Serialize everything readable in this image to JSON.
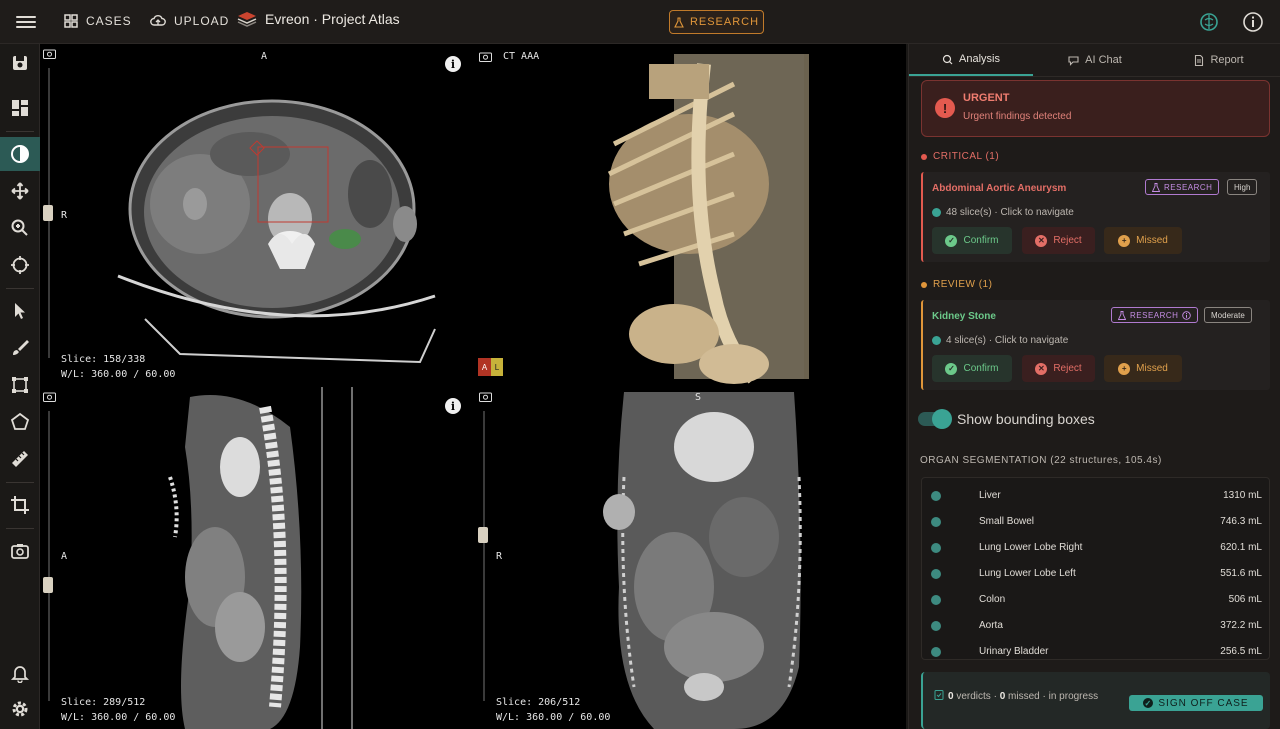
{
  "topbar": {
    "cases_label": "CASES",
    "upload_label": "UPLOAD",
    "brand_title": "Evreon · Project Atlas",
    "research_label": "RESEARCH"
  },
  "viewports": {
    "axial": {
      "orientation_top": "A",
      "orientation_left": "R",
      "slice": "Slice: 158/338",
      "wl": "W/L: 360.00 / 60.00"
    },
    "volume": {
      "label": "CT AAA",
      "orient_a": "A",
      "orient_l": "L"
    },
    "sagittal": {
      "orientation_left": "A",
      "slice": "Slice: 289/512",
      "wl": "W/L: 360.00 / 60.00"
    },
    "coronal": {
      "orientation_top": "S",
      "orientation_left": "R",
      "slice": "Slice: 206/512",
      "wl": "W/L: 360.00 / 60.00"
    }
  },
  "panel": {
    "tabs": [
      {
        "label": "Analysis",
        "icon": "brain-search-icon"
      },
      {
        "label": "AI Chat",
        "icon": "chat-icon"
      },
      {
        "label": "Report",
        "icon": "document-icon"
      }
    ],
    "urgent": {
      "title": "URGENT",
      "subtitle": "Urgent findings detected"
    },
    "critical_header": "CRITICAL (1)",
    "review_header": "REVIEW (1)",
    "findings": [
      {
        "title": "Abdominal Aortic Aneurysm",
        "badge": "RESEARCH",
        "severity": "High",
        "slices": "48 slice(s) · Click to navigate",
        "confirm": "Confirm",
        "reject": "Reject",
        "missed": "Missed",
        "color": "#e36e66"
      },
      {
        "title": "Kidney Stone",
        "badge": "RESEARCH",
        "severity": "Moderate",
        "slices": "4 slice(s) · Click to navigate",
        "confirm": "Confirm",
        "reject": "Reject",
        "missed": "Missed",
        "color": "#6cc98a"
      }
    ],
    "toggle_label": "Show bounding boxes",
    "segmentation_header": "ORGAN SEGMENTATION (22 structures, 105.4s)",
    "organs": [
      {
        "name": "Liver",
        "volume": "1310 mL"
      },
      {
        "name": "Small Bowel",
        "volume": "746.3 mL"
      },
      {
        "name": "Lung Lower Lobe Right",
        "volume": "620.1 mL"
      },
      {
        "name": "Lung Lower Lobe Left",
        "volume": "551.6 mL"
      },
      {
        "name": "Colon",
        "volume": "506 mL"
      },
      {
        "name": "Aorta",
        "volume": "372.2 mL"
      },
      {
        "name": "Urinary Bladder",
        "volume": "256.5 mL"
      }
    ],
    "footer": {
      "verdicts": "0",
      "verdicts_label": "verdicts",
      "missed": "0",
      "missed_label": "missed",
      "status": "in progress",
      "signoff_label": "SIGN OFF CASE"
    }
  },
  "colors": {
    "accent": "#3aa394",
    "critical": "#e35a4f",
    "review": "#e0963a",
    "research": "#c58de4"
  }
}
